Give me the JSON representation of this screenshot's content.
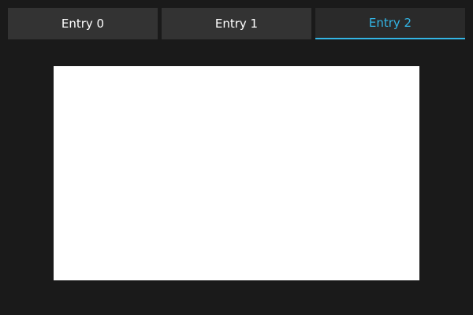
{
  "tabs": [
    {
      "label": "Entry 0",
      "selected": false
    },
    {
      "label": "Entry 1",
      "selected": false
    },
    {
      "label": "Entry 2",
      "selected": true
    }
  ],
  "colors": {
    "background": "#1a1a1a",
    "tab_background": "#333333",
    "tab_text": "#ffffff",
    "accent": "#33b5e5",
    "panel": "#ffffff"
  }
}
